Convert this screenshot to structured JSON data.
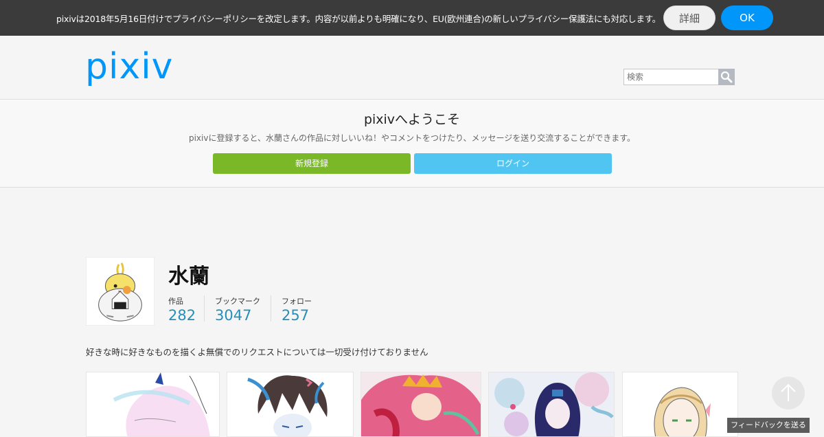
{
  "privacy": {
    "text": "pixivは2018年5月16日付けでプライバシーポリシーを改定します。内容が以前よりも明確になり、EU(欧州連合)の新しいプライバシー保護法にも対応します。",
    "detail_label": "詳細",
    "ok_label": "OK"
  },
  "header": {
    "logo_text": "pixiv",
    "search_placeholder": "検索",
    "icons": {
      "search": "search-icon"
    },
    "accent": "#0096fa"
  },
  "welcome": {
    "title": "pixivへようこそ",
    "description": "pixivに登録すると、水蘭さんの作品に対しいいね！やコメントをつけたり、メッセージを送り交流することができます。",
    "signup_label": "新規登録",
    "login_label": "ログイン",
    "signup_color": "#7ab828",
    "login_color": "#51c5f2"
  },
  "profile": {
    "name": "水蘭",
    "bio": "好きな時に好きなものを描くよ無償でのリクエストについては一切受け付けておりません",
    "stats": [
      {
        "label": "作品",
        "value": "282"
      },
      {
        "label": "ブックマーク",
        "value": "3047"
      },
      {
        "label": "フォロー",
        "value": "257"
      }
    ]
  },
  "artworks": [
    {
      "name": "artwork-1"
    },
    {
      "name": "artwork-2"
    },
    {
      "name": "artwork-3"
    },
    {
      "name": "artwork-4"
    },
    {
      "name": "artwork-5"
    }
  ],
  "footer": {
    "feedback_label": "フィードバックを送る",
    "scroll_icon": "arrow-up-icon"
  }
}
